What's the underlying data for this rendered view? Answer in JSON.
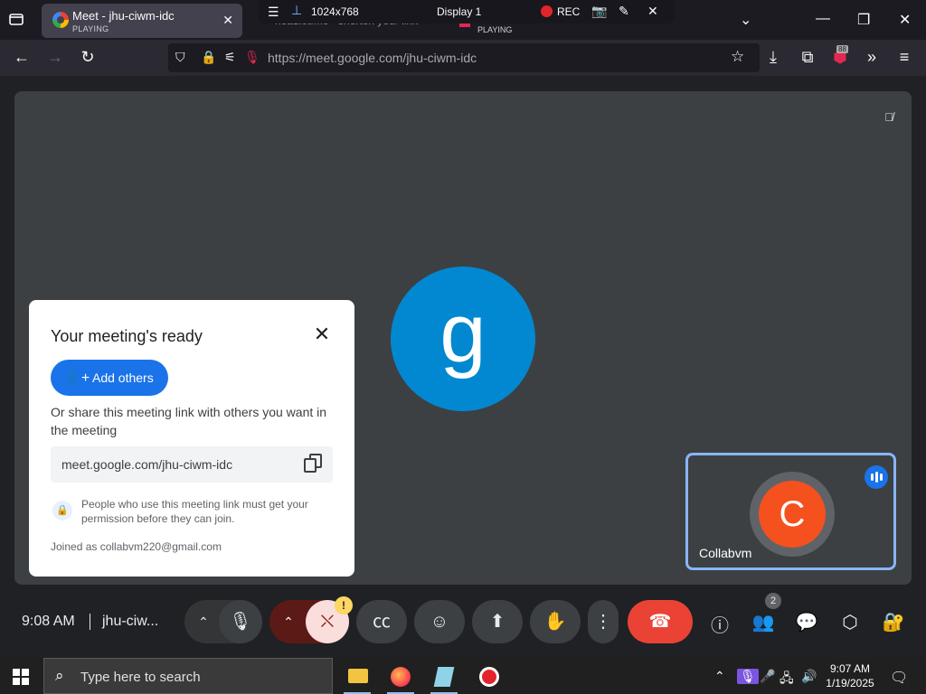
{
  "browser": {
    "active_tab": {
      "title": "Meet - jhu-ciwm-idc",
      "status": "PLAYING"
    },
    "bg_tab": {
      "title": "headlet.me - shorten your link",
      "status": "PLAYING"
    },
    "url_host": "https://meet.google.com/",
    "url_path": "jhu-ciwm-idc",
    "extension_badge": "88"
  },
  "recorder": {
    "resolution": "1024x768",
    "display": "Display 1",
    "rec_label": "REC"
  },
  "meet": {
    "dialog": {
      "title": "Your meeting's ready",
      "add_others": "Add others",
      "share_text": "Or share this meeting link with others you want in the meeting",
      "link": "meet.google.com/jhu-ciwm-idc",
      "permission_text": "People who use this meeting link must get your permission before they can join.",
      "joined_as": "Joined as collabvm220@gmail.com"
    },
    "main_avatar_letter": "g",
    "self_tile": {
      "avatar_letter": "C",
      "name": "Collabvm"
    },
    "time": "9:08 AM",
    "meeting_code": "jhu-ciw...",
    "people_count": "2",
    "camera_warning": "!"
  },
  "taskbar": {
    "search_placeholder": "Type here to search",
    "clock_time": "9:07 AM",
    "clock_date": "1/19/2025"
  },
  "colors": {
    "meet_blue": "#1a73e8",
    "hangup_red": "#ea4335",
    "avatar_blue": "#0288d1",
    "avatar_orange": "#f4511e",
    "tile_bg": "#3c4043"
  }
}
